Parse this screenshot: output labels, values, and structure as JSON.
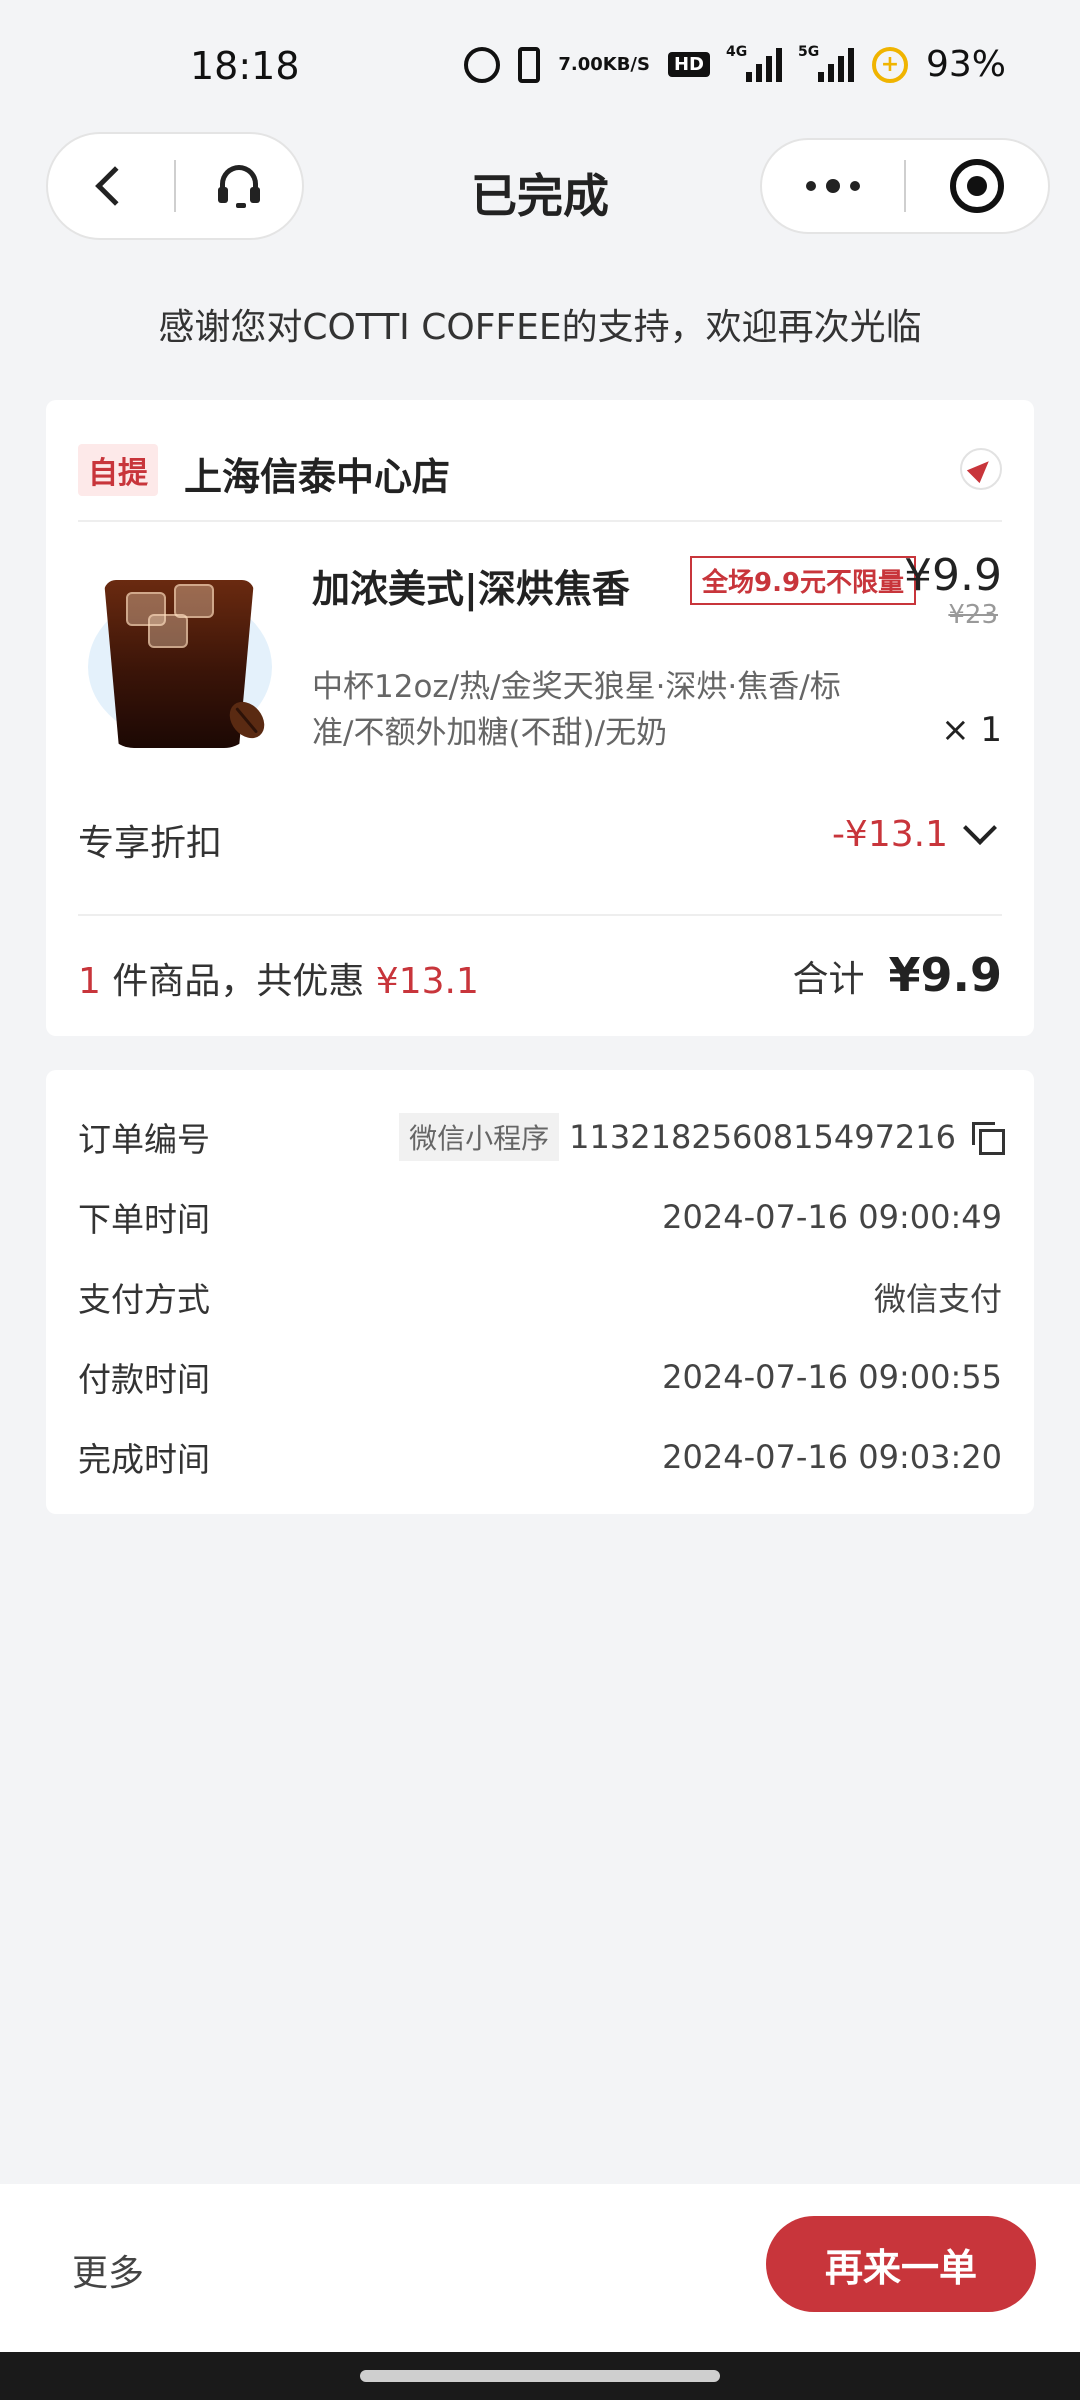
{
  "status_bar": {
    "time": "18:18",
    "net_speed_value": "7.00",
    "net_speed_unit": "KB/S",
    "hd_label": "HD",
    "signal1_label": "4G",
    "signal2_label": "5G",
    "battery": "93%"
  },
  "header": {
    "title": "已完成"
  },
  "thanks_message": "感谢您对COTTI COFFEE的支持，欢迎再次光临",
  "order": {
    "pickup_tag": "自提",
    "store_name": "上海信泰中心店",
    "product": {
      "name": "加浓美式|深烘焦香",
      "promo_tag": "全场9.9元不限量",
      "price": "¥9.9",
      "original_price": "¥23",
      "spec": "中杯12oz/热/金奖天狼星·深烘·焦香/标准/不额外加糖(不甜)/无奶",
      "quantity": "× 1"
    },
    "discount": {
      "label": "专享折扣",
      "value": "-¥13.1"
    },
    "summary": {
      "count": "1",
      "count_text": " 件商品，共优惠 ",
      "saved": "¥13.1",
      "total_label": "合计",
      "total_value": "¥9.9"
    }
  },
  "order_info": {
    "order_no_label": "订单编号",
    "order_no_tag": "微信小程序",
    "order_no": "1132182560815497216",
    "order_time_label": "下单时间",
    "order_time": "2024-07-16 09:00:49",
    "pay_method_label": "支付方式",
    "pay_method": "微信支付",
    "pay_time_label": "付款时间",
    "pay_time": "2024-07-16 09:00:55",
    "complete_time_label": "完成时间",
    "complete_time": "2024-07-16 09:03:20"
  },
  "bottom_bar": {
    "more": "更多",
    "reorder": "再来一单"
  },
  "colors": {
    "accent": "#c8353b",
    "background": "#f3f4f6"
  }
}
